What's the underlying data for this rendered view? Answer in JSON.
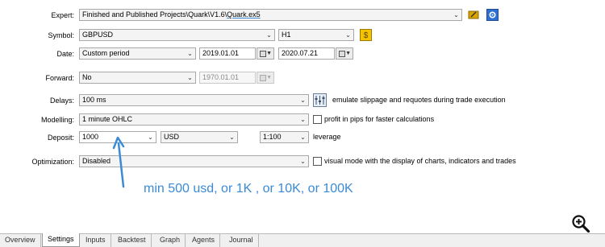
{
  "labels": {
    "expert": "Expert:",
    "symbol": "Symbol:",
    "date": "Date:",
    "forward": "Forward:",
    "delays": "Delays:",
    "modelling": "Modelling:",
    "deposit": "Deposit:",
    "optimization": "Optimization:"
  },
  "expert": {
    "path": "Finished and Published Projects\\Quark\\V1.6\\",
    "file": "Quark.ex5"
  },
  "symbol": {
    "value": "GBPUSD",
    "timeframe": "H1"
  },
  "date": {
    "mode": "Custom period",
    "from": "2019.01.01",
    "to": "2020.07.21"
  },
  "forward": {
    "value": "No",
    "date": "1970.01.01"
  },
  "delays": {
    "value": "100 ms",
    "note": "emulate slippage and requotes during trade execution"
  },
  "modelling": {
    "value": "1 minute OHLC",
    "checkbox_label": "profit in pips for faster calculations"
  },
  "deposit": {
    "amount": "1000",
    "currency": "USD",
    "leverage": "1:100",
    "leverage_label": "leverage"
  },
  "optimization": {
    "value": "Disabled",
    "checkbox_label": "visual mode with the display of charts, indicators and trades"
  },
  "annotation": "min 500 usd, or 1K , or 10K, or 100K",
  "tabs": [
    "Overview",
    "Settings",
    "Inputs",
    "Backtest",
    "Graph",
    "Agents",
    "Journal"
  ],
  "icons": [
    "chevron-down-icon",
    "calendar-icon",
    "settings-gear-icon",
    "edit-icon",
    "symbol-properties-icon",
    "delay-settings-icon",
    "zoom-in-icon"
  ],
  "colors": {
    "accent": "#3a8ad6",
    "active_tab": "#ffffff",
    "window_bg": "#ffffff"
  }
}
